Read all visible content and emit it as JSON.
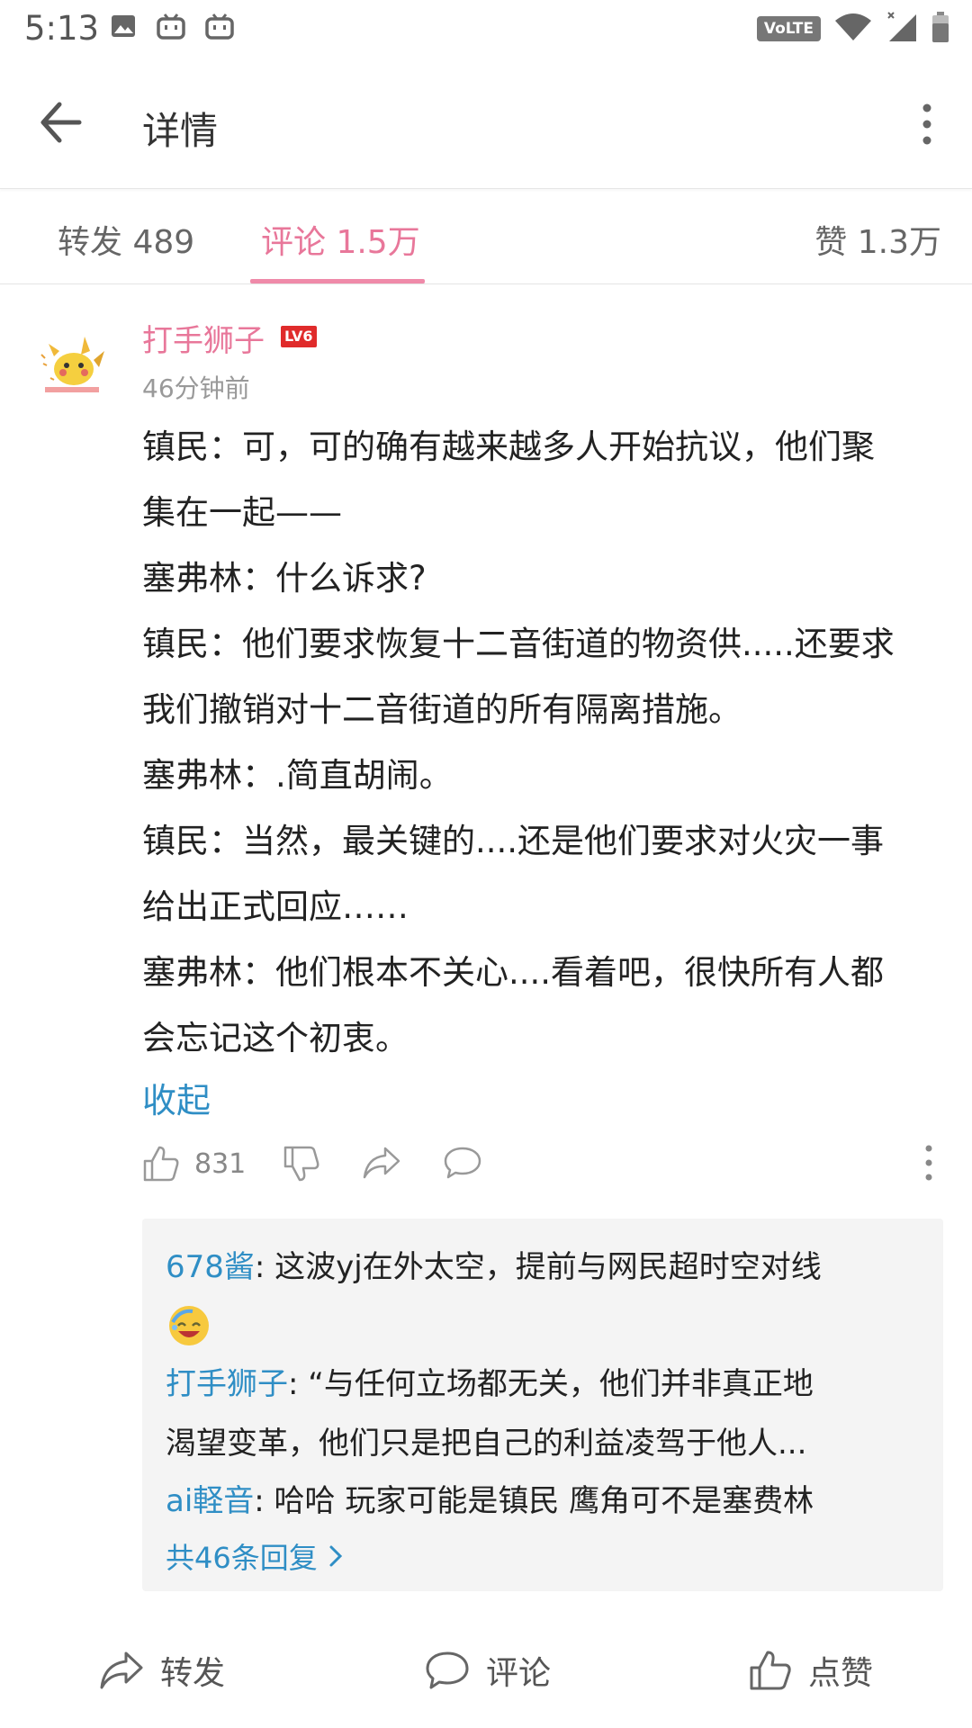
{
  "status_bar": {
    "time": "5:13",
    "network_badge": "VoLTE",
    "icons_left": [
      "gallery-icon",
      "bilibili-tv-icon",
      "bilibili-tv-icon"
    ],
    "icons_right": [
      "volte-icon",
      "wifi-icon",
      "signal-icon",
      "battery-icon"
    ]
  },
  "app_bar": {
    "title": "详情"
  },
  "tabs": [
    {
      "label": "转发 489"
    },
    {
      "label": "评论 1.5万",
      "active": true
    },
    {
      "label": "赞 1.3万"
    }
  ],
  "comment": {
    "username": "打手狮子",
    "level_badge": "LV6",
    "time_ago": "46分钟前",
    "lines": [
      "镇民：可，可的确有越来越多人开始抗议，他们聚",
      "集在一起——",
      "塞弗林：什么诉求?",
      "镇民：他们要求恢复十二音街道的物资供.....还要求",
      "我们撤销对十二音街道的所有隔离措施。",
      "塞弗林：.简直胡闹。",
      "镇民：当然，最关键的....还是他们要求对火灾一事",
      "给出正式回应……",
      "塞弗林：他们根本不关心....看着吧，很快所有人都",
      "会忘记这个初衷。"
    ],
    "collapse_label": "收起",
    "like_count": "831"
  },
  "replies": {
    "items": [
      {
        "name": "678酱",
        "text": ": 这波yj在外太空，提前与网民超时空对线"
      },
      {
        "name": "打手狮子",
        "text": ": “与任何立场都无关，他们并非真正地"
      },
      {
        "name": "",
        "text": "渴望变革，他们只是把自己的利益凌驾于他人..."
      },
      {
        "name": "ai軽音",
        "text": ": 哈哈  玩家可能是镇民  鹰角可不是塞费林"
      }
    ],
    "total_label": "共46条回复"
  },
  "bottom_bar": {
    "repost_label": "转发",
    "comment_label": "评论",
    "like_label": "点赞"
  },
  "colors": {
    "accent_pink": "#e8779a",
    "link_blue": "#2f8ec5",
    "level_red": "#e02b2b"
  }
}
